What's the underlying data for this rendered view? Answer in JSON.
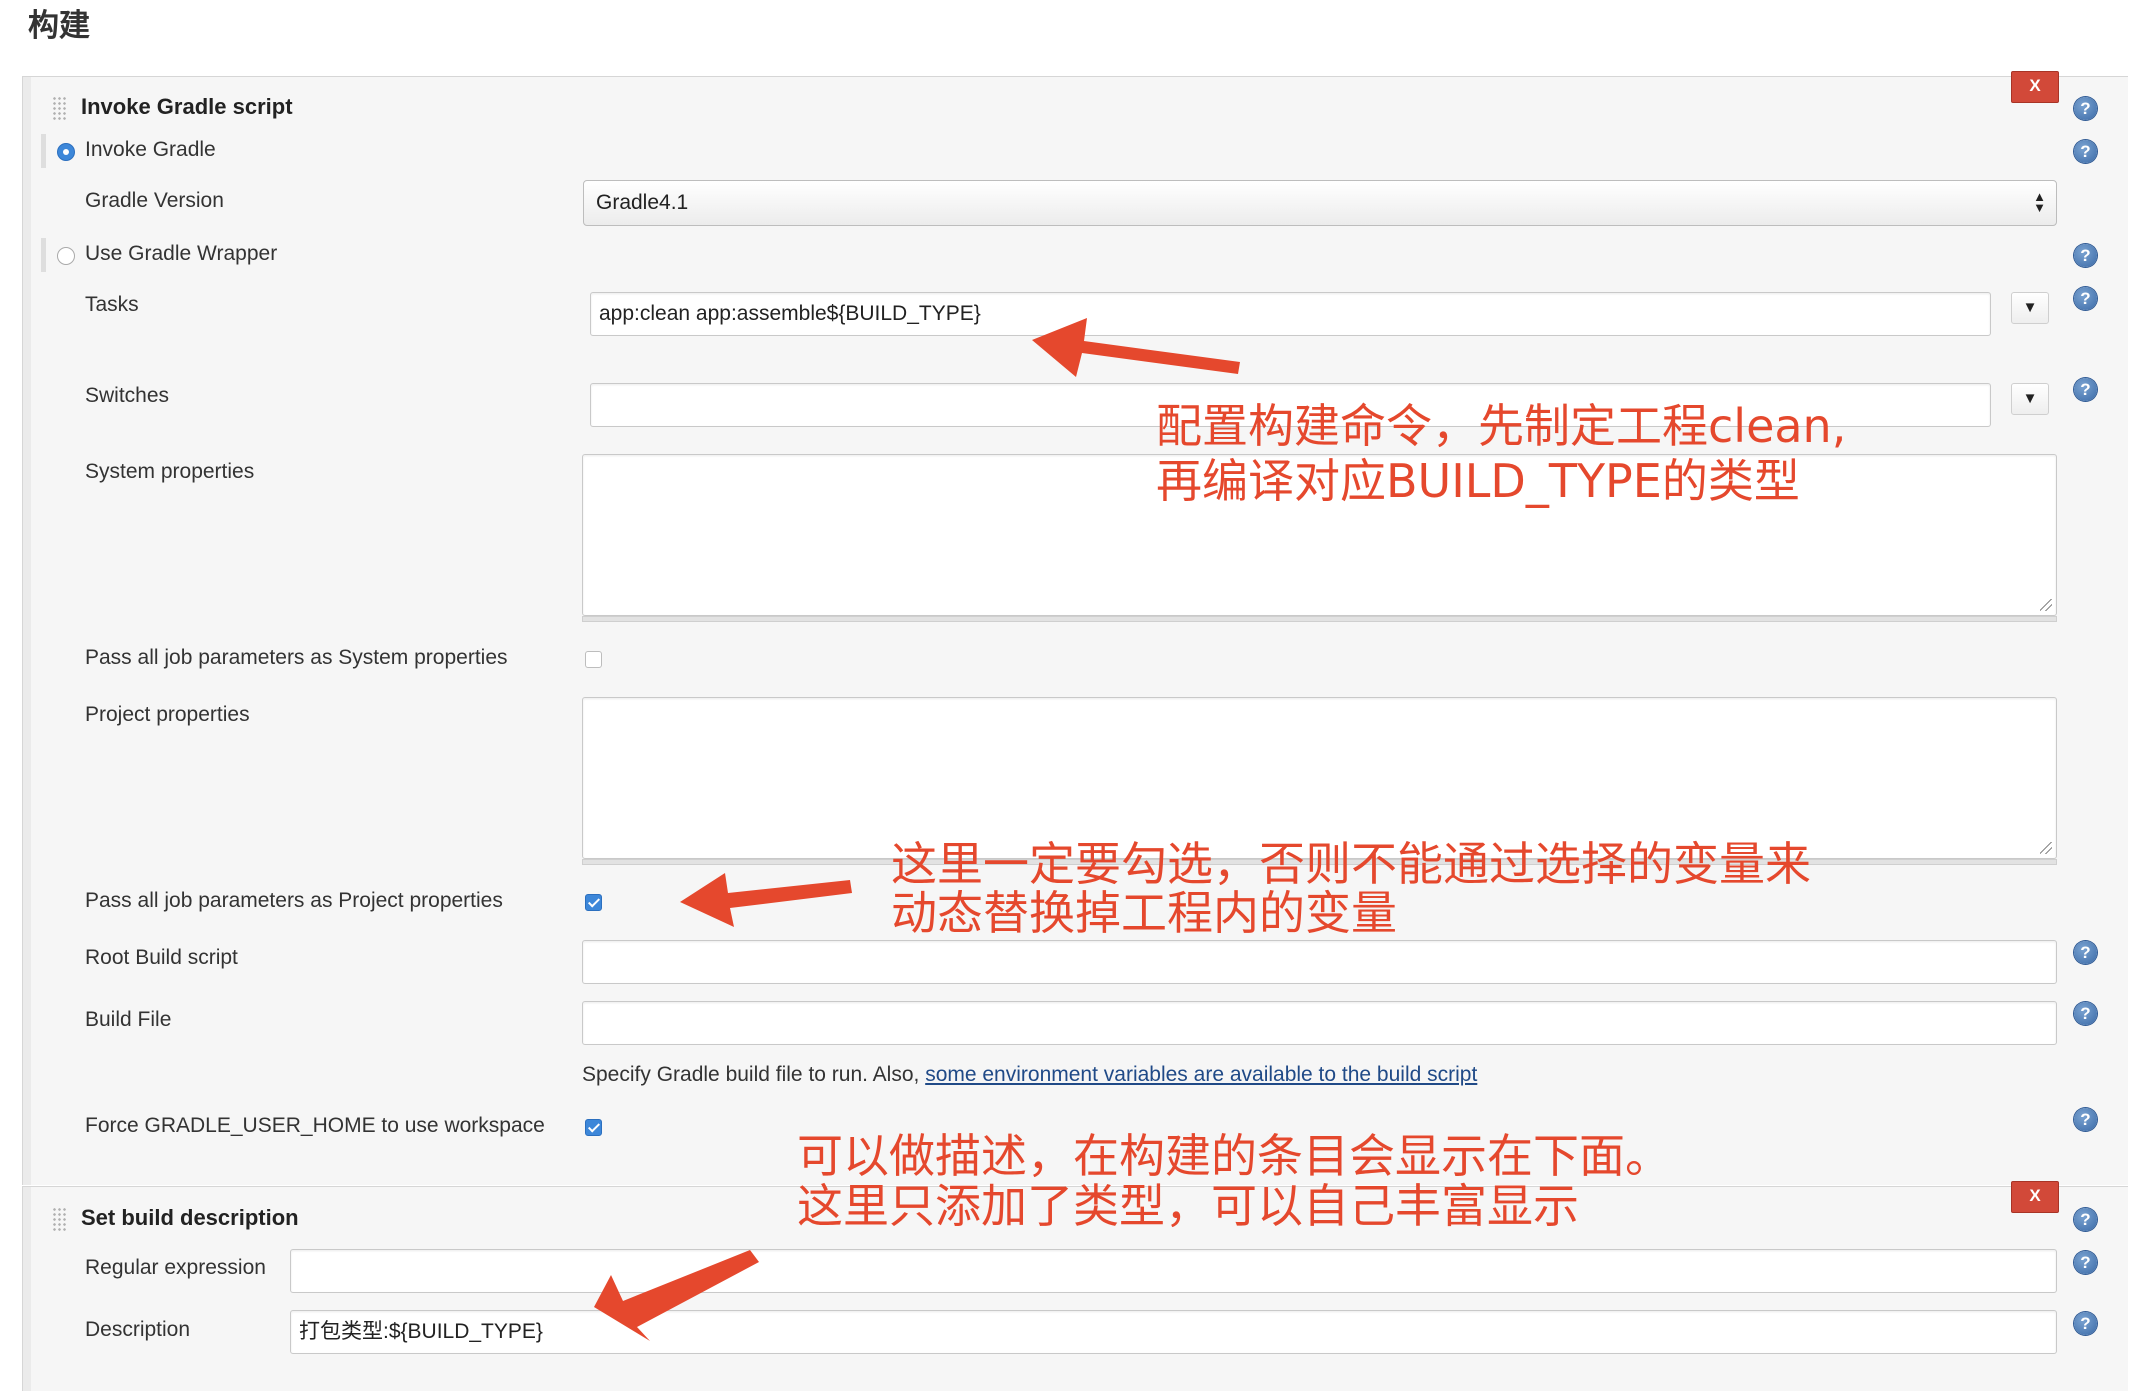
{
  "page": {
    "title": "构建"
  },
  "gradle_step": {
    "title": "Invoke Gradle script",
    "delete_label": "X",
    "help_label": "?",
    "invoke_gradle_label": "Invoke Gradle",
    "gradle_version_label": "Gradle Version",
    "gradle_version_value": "Gradle4.1",
    "use_wrapper_label": "Use Gradle Wrapper",
    "tasks_label": "Tasks",
    "tasks_value": "app:clean app:assemble${BUILD_TYPE}",
    "dropdown_glyph": "▼",
    "switches_label": "Switches",
    "switches_value": "",
    "system_properties_label": "System properties",
    "pass_system_label": "Pass all job parameters as System properties",
    "pass_system_checked": false,
    "project_properties_label": "Project properties",
    "pass_project_label": "Pass all job parameters as Project properties",
    "pass_project_checked": true,
    "root_build_script_label": "Root Build script",
    "root_build_script_value": "",
    "build_file_label": "Build File",
    "build_file_value": "",
    "build_file_help_text": "Specify Gradle build file to run. Also,",
    "build_file_help_link": "some environment variables are available to the build script",
    "force_home_label": "Force GRADLE_USER_HOME to use workspace",
    "force_home_checked": true
  },
  "description_step": {
    "title": "Set build description",
    "delete_label": "X",
    "regex_label": "Regular expression",
    "regex_value": "",
    "description_label": "Description",
    "description_value": "打包类型:${BUILD_TYPE}"
  },
  "annotations": {
    "tasks_note_line1": "配置构建命令，先制定工程clean,",
    "tasks_note_line2": "再编译对应BUILD_TYPE的类型",
    "checkbox_note_line1": "这里一定要勾选，否则不能通过选择的变量来",
    "checkbox_note_line2": "动态替换掉工程内的变量",
    "description_note_line1": "可以做描述，在构建的条目会显示在下面。",
    "description_note_line2": "这里只添加了类型，可以自己丰富显示"
  },
  "colors": {
    "annotation": "#e5482d",
    "delete_button": "#d24939",
    "checkbox_checked": "#3d87d9",
    "link": "#204a87"
  }
}
